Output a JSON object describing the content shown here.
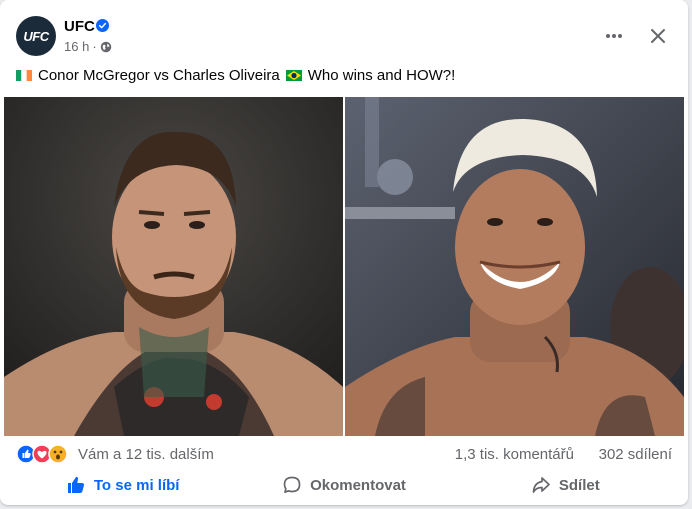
{
  "post": {
    "page_name": "UFC",
    "avatar_text": "UFC",
    "time": "16 h",
    "separator": "·",
    "caption": "Conor McGregor vs Charles Oliveira",
    "caption_end": "Who wins and HOW?!"
  },
  "stats": {
    "reactions_text": "Vám a 12 tis. dalším",
    "comments": "1,3 tis. komentářů",
    "shares": "302 sdílení"
  },
  "actions": {
    "like": "To se mi líbí",
    "comment": "Okomentovat",
    "share": "Sdílet"
  },
  "colors": {
    "brand": "#0866ff",
    "muted": "#65676b"
  },
  "icons": [
    "verified-icon",
    "globe-icon",
    "more-icon",
    "close-icon",
    "like-icon",
    "comment-icon",
    "share-icon"
  ]
}
